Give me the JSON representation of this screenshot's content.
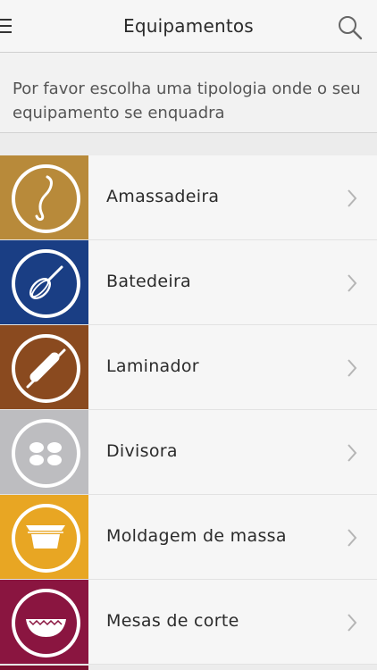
{
  "header": {
    "title": "Equipamentos",
    "menu_icon": "menu-icon",
    "search_icon": "search-icon"
  },
  "instruction": {
    "text": "Por favor escolha uma tipologia onde o seu equipamento se enquadra"
  },
  "categories": [
    {
      "label": "Amassadeira",
      "icon": "dough-hook-icon",
      "color": "#b88a3a"
    },
    {
      "label": "Batedeira",
      "icon": "whisk-icon",
      "color": "#1a3e84"
    },
    {
      "label": "Laminador",
      "icon": "rolling-pin-icon",
      "color": "#8a4a1f"
    },
    {
      "label": "Divisora",
      "icon": "dough-portions-icon",
      "color": "#bdbdc0"
    },
    {
      "label": "Moldagem de massa",
      "icon": "mold-icon",
      "color": "#e8a623"
    },
    {
      "label": "Mesas de corte",
      "icon": "cutting-table-icon",
      "color": "#8a1540"
    }
  ],
  "colors": {
    "header_bg": "#f6f6f6",
    "page_bg": "#ececec",
    "chevron": "#b5b5b5"
  }
}
